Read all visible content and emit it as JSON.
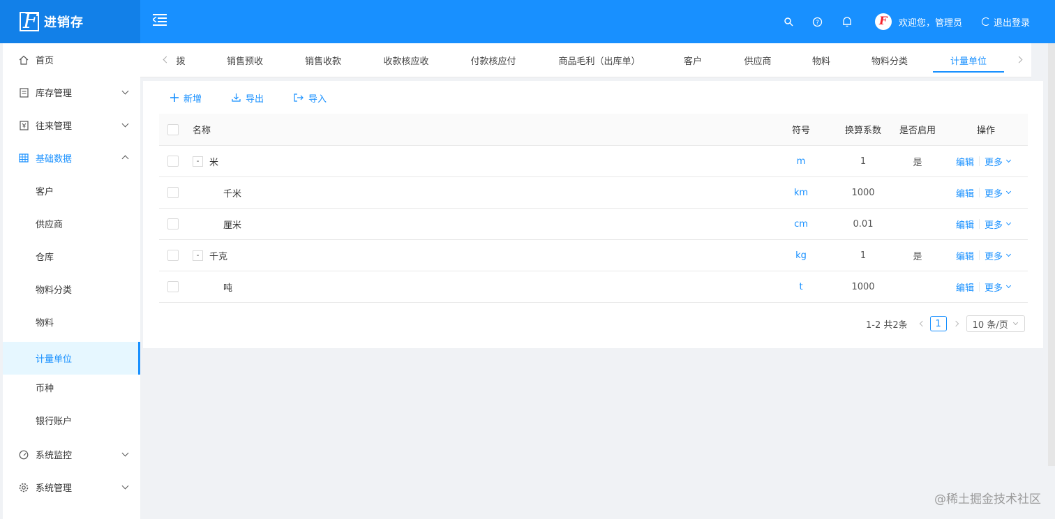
{
  "app": {
    "title": "进销存"
  },
  "header": {
    "user_greeting": "欢迎您，管理员",
    "logout_label": "退出登录",
    "icons": [
      "search-icon",
      "help-icon",
      "bell-icon"
    ]
  },
  "sidebar": {
    "items": [
      {
        "label": "首页",
        "icon": "home-icon"
      },
      {
        "label": "库存管理",
        "icon": "inventory-icon"
      },
      {
        "label": "往来管理",
        "icon": "account-icon"
      },
      {
        "label": "基础数据",
        "icon": "table-icon"
      },
      {
        "label": "系统监控",
        "icon": "dashboard-icon"
      },
      {
        "label": "系统管理",
        "icon": "settings-icon"
      }
    ],
    "sub_items": [
      "客户",
      "供应商",
      "仓库",
      "物料分类",
      "物料",
      "计量单位",
      "币种",
      "银行账户"
    ],
    "active_sub": "计量单位"
  },
  "tabs": [
    "拨",
    "销售预收",
    "销售收款",
    "收款核应收",
    "付款核应付",
    "商品毛利（出库单）",
    "客户",
    "供应商",
    "物料",
    "物料分类",
    "计量单位"
  ],
  "active_tab": "计量单位",
  "toolbar": {
    "add": "新增",
    "export": "导出",
    "import": "导入"
  },
  "table": {
    "columns": {
      "name": "名称",
      "symbol": "符号",
      "factor": "换算系数",
      "enabled": "是否启用",
      "action": "操作"
    },
    "rows": [
      {
        "name": "米",
        "symbol": "m",
        "factor": "1",
        "enabled": "是",
        "level": 0,
        "expand": "-"
      },
      {
        "name": "千米",
        "symbol": "km",
        "factor": "1000",
        "enabled": "",
        "level": 1
      },
      {
        "name": "厘米",
        "symbol": "cm",
        "factor": "0.01",
        "enabled": "",
        "level": 1
      },
      {
        "name": "千克",
        "symbol": "kg",
        "factor": "1",
        "enabled": "是",
        "level": 0,
        "expand": "-"
      },
      {
        "name": "吨",
        "symbol": "t",
        "factor": "1000",
        "enabled": "",
        "level": 1
      }
    ],
    "edit_label": "编辑",
    "more_label": "更多"
  },
  "pagination": {
    "summary": "1-2 共2条",
    "current_page": "1",
    "page_size": "10 条/页"
  },
  "watermark": "@稀土掘金技术社区",
  "colors": {
    "primary": "#1890ff",
    "header": "#1890ff",
    "active_bg": "#e6f7ff"
  }
}
